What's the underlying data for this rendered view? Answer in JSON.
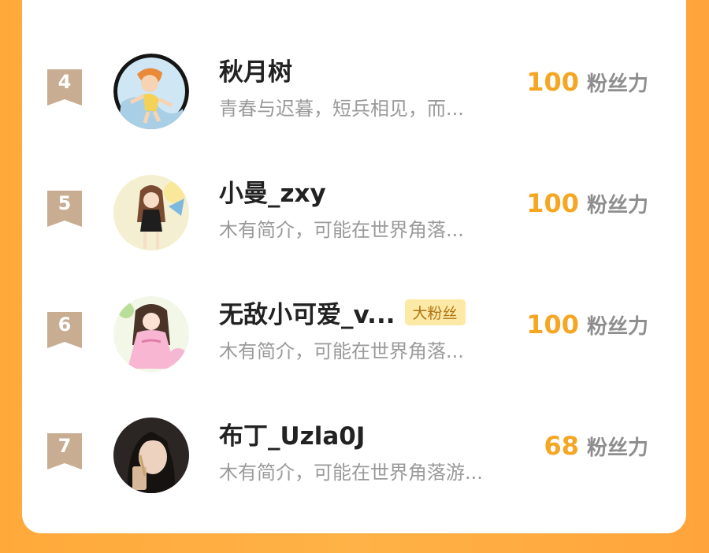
{
  "ranking": {
    "score_unit": "粉丝力",
    "rows": [
      {
        "rank": "4",
        "name": "秋月树",
        "bio": "青春与迟暮，短兵相见，而...",
        "score": "100",
        "badge": ""
      },
      {
        "rank": "5",
        "name": "小曼_zxy",
        "bio": "木有简介，可能在世界角落...",
        "score": "100",
        "badge": ""
      },
      {
        "rank": "6",
        "name": "无敌小可爱_v...",
        "bio": "木有简介，可能在世界角落...",
        "score": "100",
        "badge": "大粉丝"
      },
      {
        "rank": "7",
        "name": "布丁_Uzla0J",
        "bio": "木有简介，可能在世界角落游...",
        "score": "68",
        "badge": ""
      }
    ]
  },
  "colors": {
    "background": "#FFA93A",
    "score": "#F5A623",
    "rank_ribbon": "#C8AD92",
    "badge_bg": "#FCE9A6"
  },
  "icons": {
    "rank": "ribbon-bookmark-icon"
  }
}
